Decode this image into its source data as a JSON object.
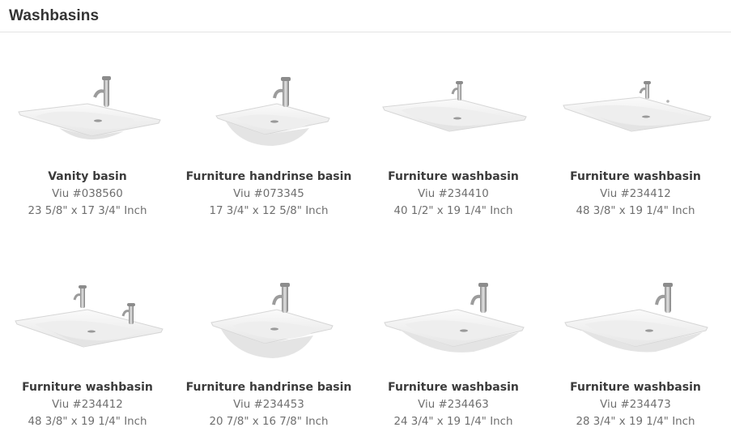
{
  "header": {
    "title": "Washbasins"
  },
  "products": [
    {
      "name": "Vanity basin",
      "sku": "Viu #038560",
      "dims": "23 5/8\" x 17 3/4\" Inch",
      "icon": "basin-one-tap-deep"
    },
    {
      "name": "Furniture handrinse basin",
      "sku": "Viu #073345",
      "dims": "17 3/4\" x 12 5/8\" Inch",
      "icon": "basin-one-tap-compact"
    },
    {
      "name": "Furniture washbasin",
      "sku": "Viu #234410",
      "dims": "40 1/2\" x 19 1/4\" Inch",
      "icon": "basin-wide"
    },
    {
      "name": "Furniture washbasin",
      "sku": "Viu #234412",
      "dims": "48 3/8\" x 19 1/4\" Inch",
      "icon": "basin-wide-long"
    },
    {
      "name": "Furniture washbasin",
      "sku": "Viu #234412",
      "dims": "48 3/8\" x 19 1/4\" Inch",
      "icon": "basin-two-taps"
    },
    {
      "name": "Furniture handrinse basin",
      "sku": "Viu #234453",
      "dims": "20 7/8\" x 16 7/8\" Inch",
      "icon": "basin-one-tap-compact"
    },
    {
      "name": "Furniture washbasin",
      "sku": "Viu #234463",
      "dims": "24 3/4\" x 19 1/4\" Inch",
      "icon": "basin-one-tap"
    },
    {
      "name": "Furniture washbasin",
      "sku": "Viu #234473",
      "dims": "28 3/4\" x 19 1/4\" Inch",
      "icon": "basin-one-tap"
    }
  ]
}
